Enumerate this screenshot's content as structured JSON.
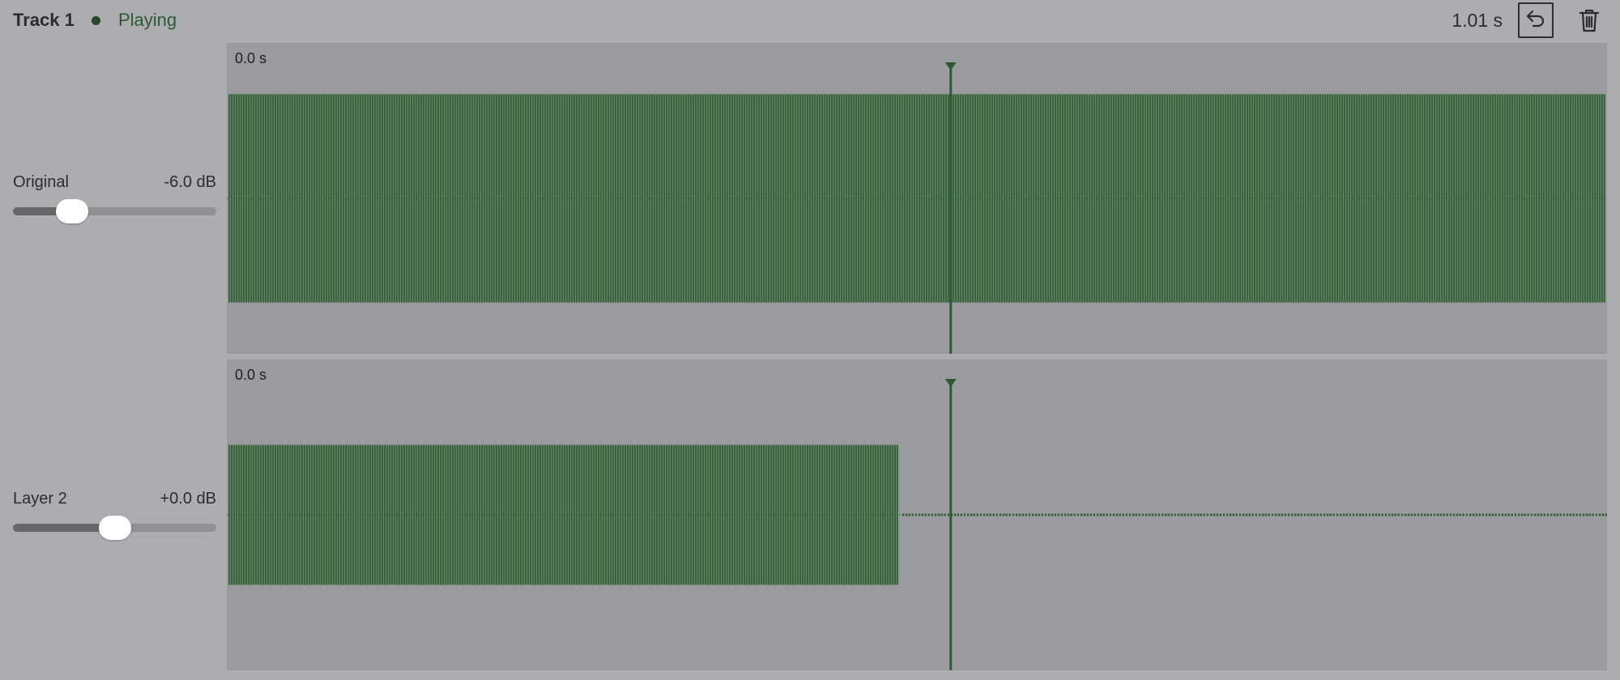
{
  "header": {
    "track_title": "Track 1",
    "status": "Playing",
    "duration": "1.01 s",
    "undo_icon": "undo-arrow-icon",
    "delete_icon": "trash-icon"
  },
  "colors": {
    "background": "#acadb1",
    "panel": "#9a9b9f",
    "waveform": "#2f5f33",
    "playhead": "#2d5a33",
    "slider_thumb": "#ffffff"
  },
  "layers": [
    {
      "name": "Original",
      "gain": "-6.0 dB",
      "slider_value": 0.29,
      "time_label": "0.0 s",
      "waveform_amplitude": 0.67,
      "waveform_end_fraction": 1.0,
      "playhead_fraction": 0.5245
    },
    {
      "name": "Layer 2",
      "gain": "+0.0 dB",
      "slider_value": 0.5,
      "time_label": "0.0 s",
      "waveform_amplitude": 0.45,
      "waveform_end_fraction": 0.487,
      "playhead_fraction": 0.5245
    }
  ]
}
